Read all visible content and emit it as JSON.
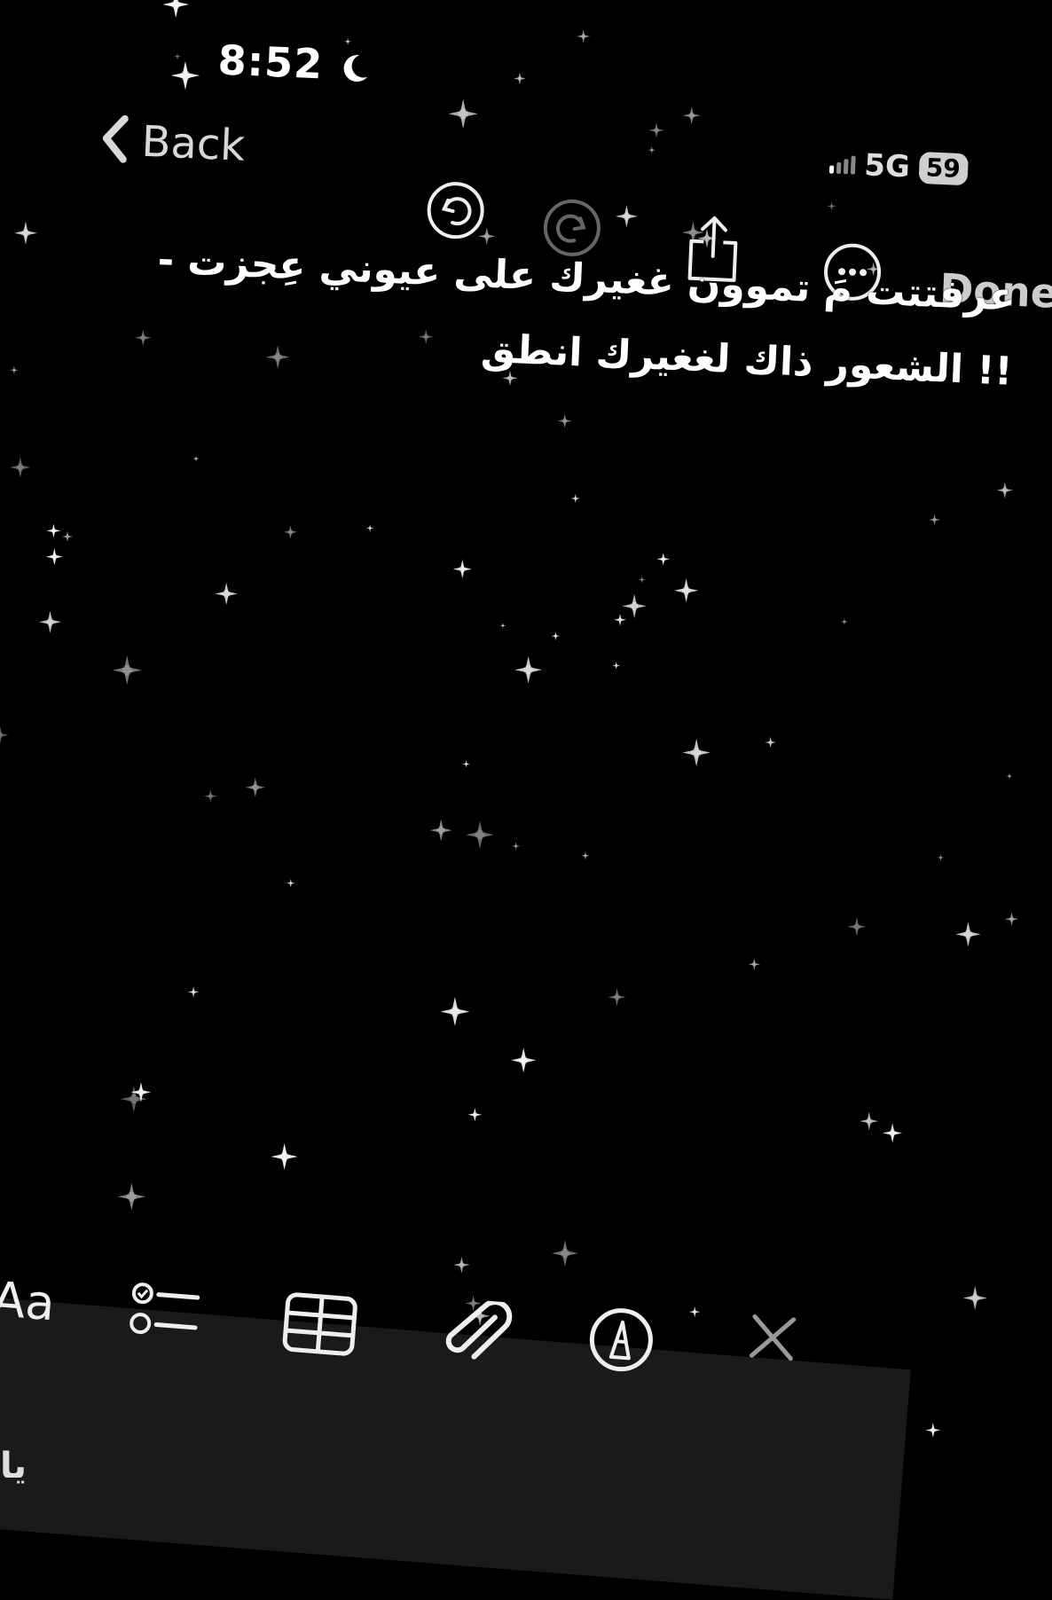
{
  "status_bar": {
    "time": "8:52",
    "network": "5G",
    "battery": "59"
  },
  "nav": {
    "back_label": "Back",
    "done_label": "Done"
  },
  "note": {
    "line1": "عرفتتت مَ تموون غغيرك على عيوني عِجزت -",
    "line2": "!! الشعور ذاك لغغيرك انطق"
  },
  "format_bar": {
    "text_format_label": "Aa",
    "keyboard_fragment": "يا"
  },
  "icons": [
    "moon-icon",
    "signal-icon",
    "chevron-left-icon",
    "undo-icon",
    "redo-icon",
    "share-icon",
    "more-icon",
    "checklist-icon",
    "table-icon",
    "paperclip-icon",
    "markup-pen-icon",
    "close-icon"
  ]
}
